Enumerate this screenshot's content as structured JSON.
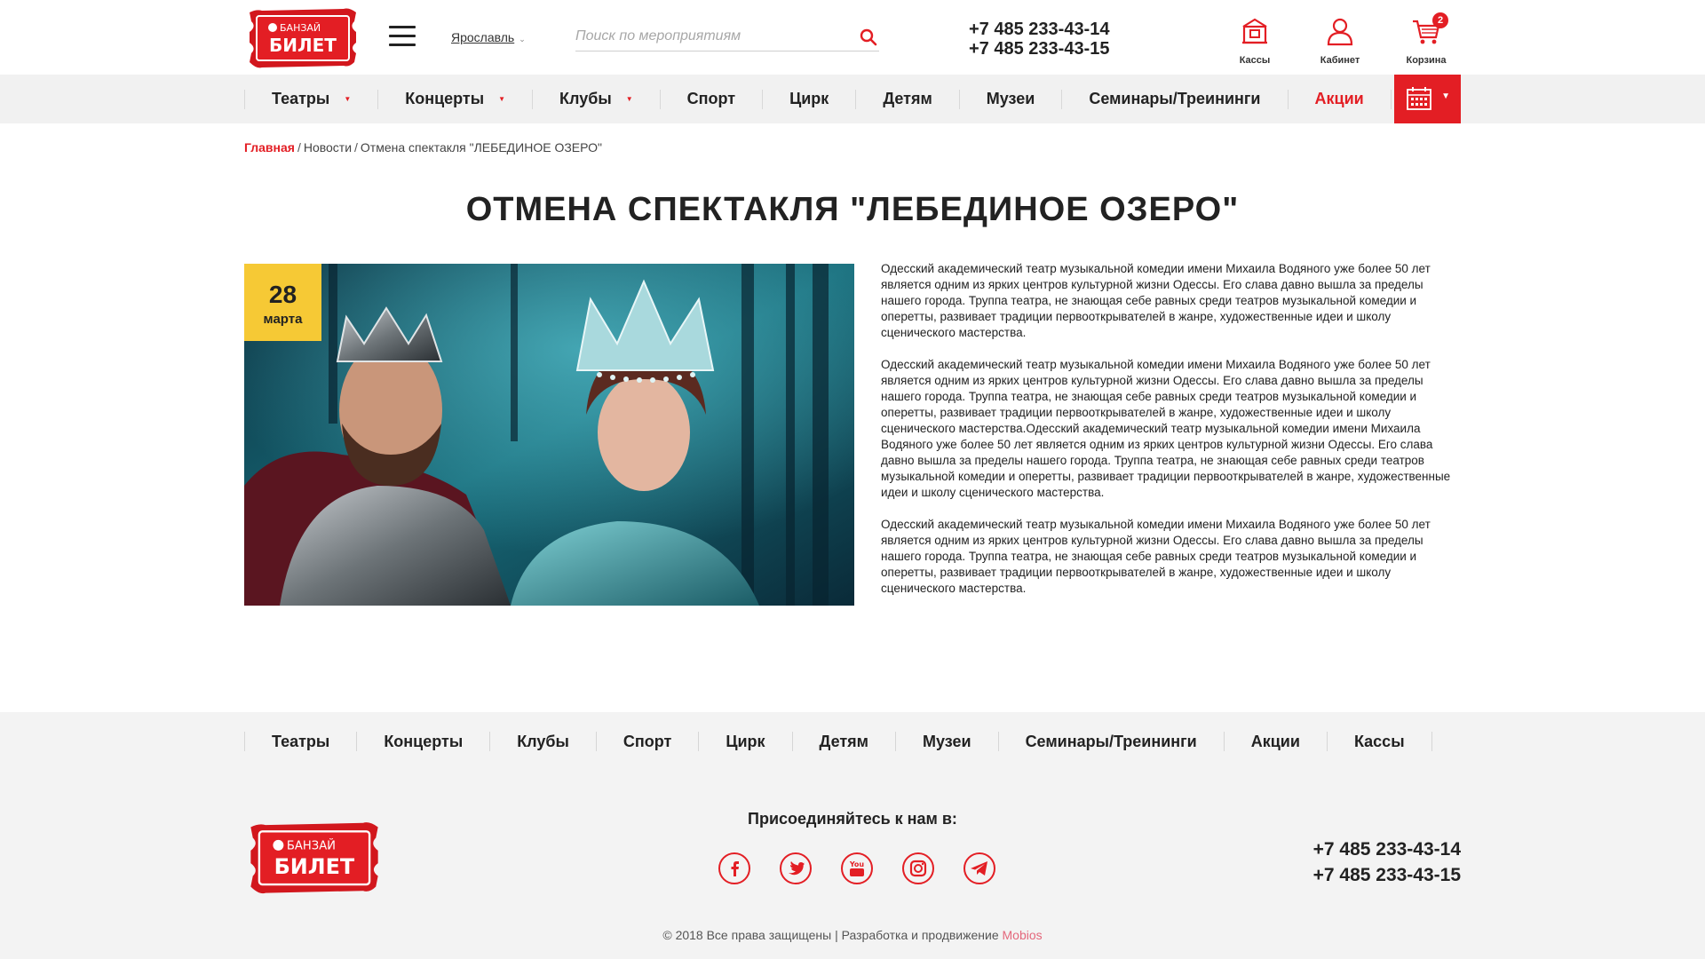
{
  "header": {
    "logo_brand": "БАНЗАЙ",
    "logo_text": "БИЛЕТ",
    "city": "Ярославль",
    "search_placeholder": "Поиск по мероприятиям",
    "phone_1": "+7 485 233-43-14",
    "phone_2": "+7 485 233-43-15",
    "tools": [
      {
        "label": "Кассы",
        "icon": "ticket-office-icon"
      },
      {
        "label": "Кабинет",
        "icon": "user-icon"
      },
      {
        "label": "Корзина",
        "icon": "cart-icon",
        "badge": "2"
      }
    ]
  },
  "nav": {
    "items": [
      {
        "label": "Театры",
        "has_dropdown": true
      },
      {
        "label": "Концерты",
        "has_dropdown": true
      },
      {
        "label": "Клубы",
        "has_dropdown": true
      },
      {
        "label": "Спорт"
      },
      {
        "label": "Цирк"
      },
      {
        "label": "Детям"
      },
      {
        "label": "Музеи"
      },
      {
        "label": "Семинары/Треининги"
      },
      {
        "label": "Акции",
        "highlight": true
      }
    ],
    "calendar_icon": "calendar-icon"
  },
  "breadcrumb": {
    "home": "Главная",
    "news": "Новости",
    "current": "Отмена спектакля \"ЛЕБЕДИНОЕ ОЗЕРО\""
  },
  "article": {
    "title": "ОТМЕНА СПЕКТАКЛЯ \"ЛЕБЕДИНОЕ ОЗЕРО\"",
    "date_day": "28",
    "date_month": "марта",
    "paragraphs": [
      "Одесский академический театр музыкальной комедии имени Михаила Водяного уже более 50 лет является одним из ярких центров культурной жизни Одессы. Его слава давно вышла за пределы нашего города. Труппа театра, не знающая себе равных среди театров музыкальной комедии и оперетты, развивает традиции первооткрывателей в жанре, художественные идеи и школу сценического мастерства.",
      "Одесский академический театр музыкальной комедии имени Михаила Водяного уже более 50 лет является одним из ярких центров культурной жизни Одессы. Его слава давно вышла за пределы нашего города. Труппа театра, не знающая себе равных среди театров музыкальной комедии и оперетты, развивает традиции первооткрывателей в жанре, художественные идеи и школу сценического мастерства.Одесский академический театр музыкальной комедии имени Михаила Водяного уже более 50 лет является одним из ярких центров культурной жизни Одессы. Его слава давно вышла за пределы нашего города. Труппа театра, не знающая себе равных среди театров музыкальной комедии и оперетты, развивает традиции первооткрывателей в жанре, художественные идеи и школу сценического мастерства.",
      "Одесский академический театр музыкальной комедии имени Михаила Водяного уже более 50 лет является одним из ярких центров культурной жизни Одессы. Его слава давно вышла за пределы нашего города. Труппа театра, не знающая себе равных среди театров музыкальной комедии и оперетты, развивает традиции первооткрывателей в жанре, художественные идеи и школу сценического мастерства."
    ]
  },
  "footer": {
    "nav": [
      "Театры",
      "Концерты",
      "Клубы",
      "Спорт",
      "Цирк",
      "Детям",
      "Музеи",
      "Семинары/Треининги",
      "Акции",
      "Кассы"
    ],
    "join_text": "Присоединяйтесь к нам в:",
    "social": [
      "facebook-icon",
      "twitter-icon",
      "youtube-icon",
      "instagram-icon",
      "telegram-icon"
    ],
    "phone_1": "+7 485 233-43-14",
    "phone_2": "+7 485 233-43-15",
    "copyright": "© 2018 Все права защищены | Разработка и продвижение",
    "developer": "Mobios"
  },
  "colors": {
    "accent": "#e31e24",
    "date_badge": "#f6c935",
    "nav_bg": "#f1f1f1",
    "footer_bg": "#f3f3f3"
  }
}
